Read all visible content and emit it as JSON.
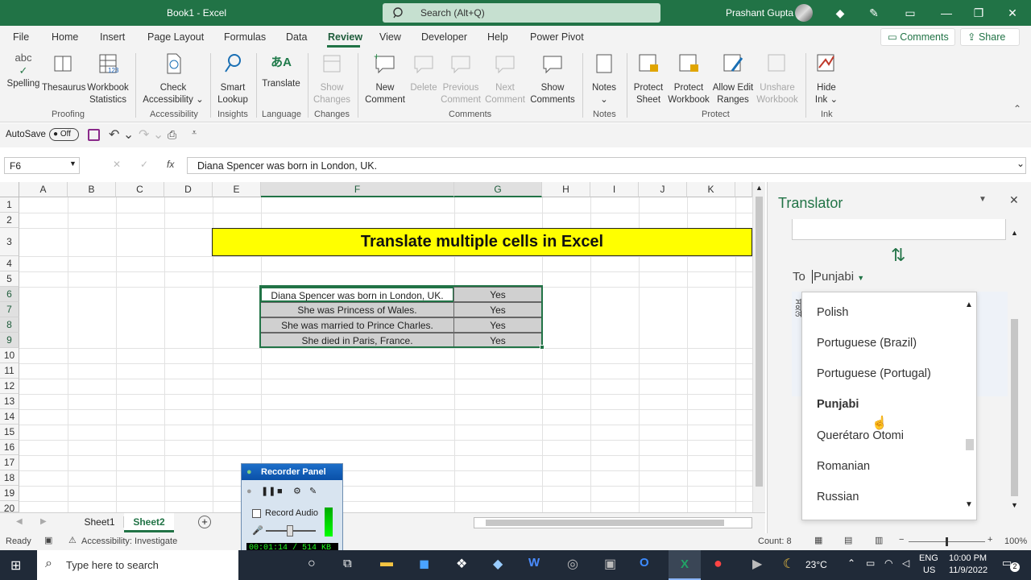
{
  "window": {
    "title": "Book1  -  Excel",
    "search_placeholder": "Search (Alt+Q)",
    "user": "Prashant Gupta"
  },
  "tabs": [
    "File",
    "Home",
    "Insert",
    "Page Layout",
    "Formulas",
    "Data",
    "Review",
    "View",
    "Developer",
    "Help",
    "Power Pivot"
  ],
  "active_tab": "Review",
  "top_buttons": {
    "comments": "Comments",
    "share": "Share"
  },
  "ribbon": {
    "spelling": "Spelling",
    "thesaurus": "Thesaurus",
    "workbook_stats_1": "Workbook",
    "workbook_stats_2": "Statistics",
    "check_acc_1": "Check",
    "check_acc_2": "Accessibility",
    "smart_1": "Smart",
    "smart_2": "Lookup",
    "translate": "Translate",
    "show_changes_1": "Show",
    "show_changes_2": "Changes",
    "new_comment_1": "New",
    "new_comment_2": "Comment",
    "delete": "Delete",
    "prev_1": "Previous",
    "prev_2": "Comment",
    "next_1": "Next",
    "next_2": "Comment",
    "show_comments_1": "Show",
    "show_comments_2": "Comments",
    "notes": "Notes",
    "protect_sheet_1": "Protect",
    "protect_sheet_2": "Sheet",
    "protect_wb_1": "Protect",
    "protect_wb_2": "Workbook",
    "allow_edit_1": "Allow Edit",
    "allow_edit_2": "Ranges",
    "unshare_1": "Unshare",
    "unshare_2": "Workbook",
    "hide_ink_1": "Hide",
    "hide_ink_2": "Ink",
    "groups": {
      "proofing": "Proofing",
      "accessibility": "Accessibility",
      "insights": "Insights",
      "language": "Language",
      "changes": "Changes",
      "comments": "Comments",
      "notes": "Notes",
      "protect": "Protect",
      "ink": "Ink"
    }
  },
  "qat": {
    "autosave": "AutoSave",
    "toggle": "Off"
  },
  "formula": {
    "namebox": "F6",
    "fx": "fx",
    "content": "Diana Spencer was born in London, UK."
  },
  "columns": [
    "A",
    "B",
    "C",
    "D",
    "E",
    "F",
    "G",
    "H",
    "I",
    "J",
    "K"
  ],
  "rows": [
    "1",
    "2",
    "3",
    "4",
    "5",
    "6",
    "7",
    "8",
    "9",
    "10",
    "11",
    "12",
    "13",
    "14",
    "15",
    "16",
    "17",
    "18",
    "19",
    "20"
  ],
  "banner": "Translate multiple cells in Excel",
  "table": [
    {
      "f": "Diana Spencer was born in London, UK.",
      "g": "Yes"
    },
    {
      "f": "She was Princess of Wales.",
      "g": "Yes"
    },
    {
      "f": "She was married to Prince Charles.",
      "g": "Yes"
    },
    {
      "f": "She died in Paris, France.",
      "g": "Yes"
    }
  ],
  "sheets": [
    "Sheet1",
    "Sheet2"
  ],
  "active_sheet": "Sheet2",
  "status": {
    "ready": "Ready",
    "accessibility": "Accessibility: Investigate",
    "count": "Count: 8",
    "zoom": "100%"
  },
  "translator": {
    "title": "Translator",
    "to_label": "To",
    "language": "Punjabi",
    "options": [
      "Polish",
      "Portuguese (Brazil)",
      "Portuguese (Portugal)",
      "Punjabi",
      "Querétaro Otomi",
      "Romanian",
      "Russian"
    ],
    "selected": "Punjabi"
  },
  "recorder": {
    "title": "Recorder Panel",
    "record_audio": "Record Audio",
    "time": "00:01:14 / 514 KB"
  },
  "taskbar": {
    "search": "Type here to search",
    "temp": "23°C",
    "lang_1": "ENG",
    "lang_2": "US",
    "time": "10:00 PM",
    "date": "11/9/2022",
    "notif": "2"
  }
}
